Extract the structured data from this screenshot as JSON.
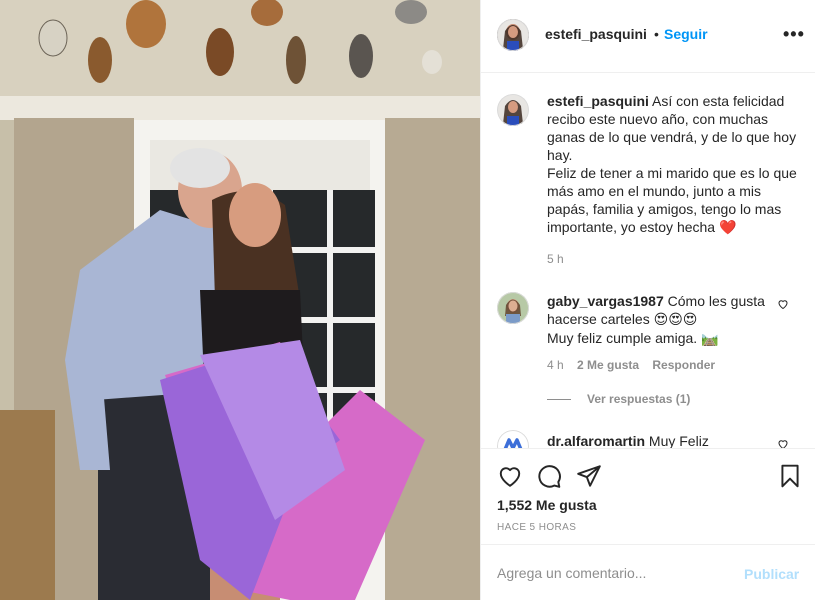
{
  "post": {
    "username": "estefi_pasquini",
    "separator": "•",
    "follow_label": "Seguir",
    "more_icon": "more-options-icon",
    "caption_lines": [
      "Así con esta felicidad recibo este nuevo año, con muchas ganas de lo que vendrá, y de lo que hoy hay.",
      "Feliz de tener a mi marido que es lo que más amo en el mundo, junto a mis papás, familia y amigos, tengo lo mas importante, yo estoy hecha"
    ],
    "caption_emoji": "❤️",
    "caption_time": "5 h",
    "likes": "1,552 Me gusta",
    "time_ago": "HACE 5 HORAS"
  },
  "comments": [
    {
      "username": "gaby_vargas1987",
      "text": "Cómo les gusta hacerse carteles",
      "emoji_1": "😍😍😍",
      "text_2": "Muy feliz cumple amiga.",
      "emoji_2": "🛤️",
      "time": "4 h",
      "likes": "2 Me gusta",
      "reply_label": "Responder",
      "view_replies": "Ver respuestas (1)"
    },
    {
      "username": "dr.alfaromartin",
      "text": "Muy Feliz"
    }
  ],
  "composer": {
    "placeholder": "Agrega un comentario...",
    "publish_label": "Publicar"
  },
  "colors": {
    "accent": "#0095f6",
    "publish_disabled": "#b2dffc",
    "muted": "#8e8e8e",
    "heart": "#ed4956"
  }
}
